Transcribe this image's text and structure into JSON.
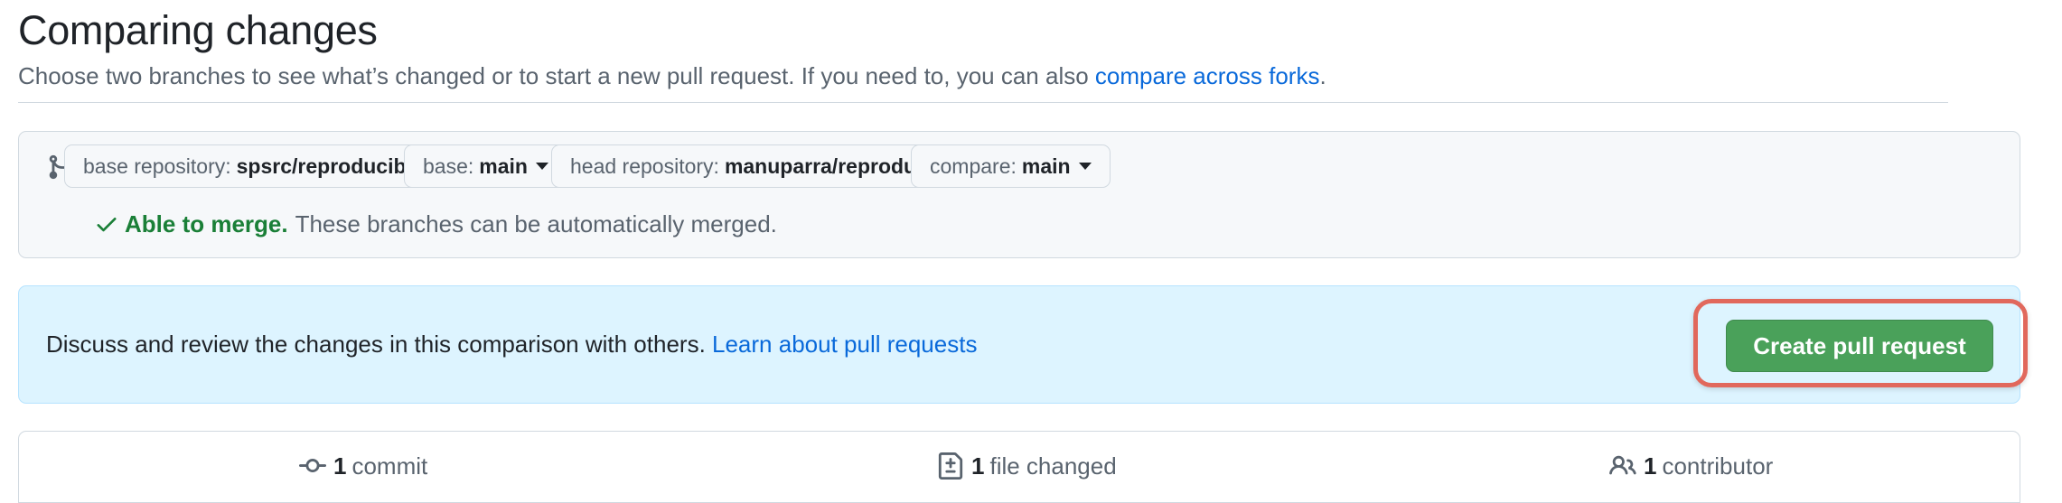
{
  "header": {
    "title": "Comparing changes",
    "subtitle_text": "Choose two branches to see what’s changed or to start a new pull request. If you need to, you can also ",
    "subtitle_link": "compare across forks",
    "subtitle_end": "."
  },
  "range": {
    "icon": "compare-arrows-icon",
    "base_repo_label": "base repository:",
    "base_repo_value": "spsrc/reproducibility-course",
    "base_label": "base:",
    "base_value": "main",
    "arrow_icon": "arrow-left-icon",
    "head_repo_label": "head repository:",
    "head_repo_value": "manuparra/reproducibility-co...",
    "compare_label": "compare:",
    "compare_value": "main",
    "merge_status": "Able to merge.",
    "merge_message": "These branches can be automatically merged."
  },
  "info": {
    "text": "Discuss and review the changes in this comparison with others. ",
    "link": "Learn about pull requests",
    "create_button": "Create pull request"
  },
  "stats": {
    "commits_count": "1",
    "commits_label": "commit",
    "files_count": "1",
    "files_label": "file changed",
    "contributors_count": "1",
    "contributors_label": "contributor"
  },
  "colors": {
    "accent_link": "#0969da",
    "success": "#1a7f37",
    "button_green": "#4aa15a",
    "highlight_outline": "#e1685c",
    "info_bg": "#ddf4ff"
  }
}
